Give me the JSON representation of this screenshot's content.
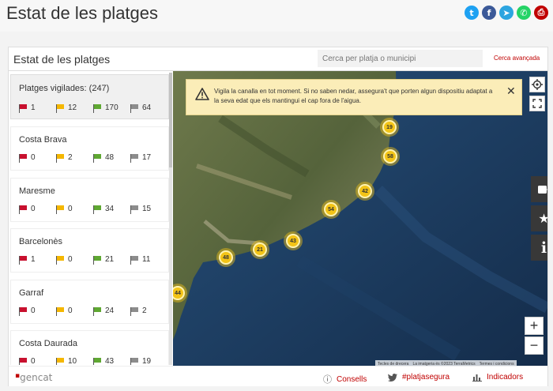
{
  "page": {
    "title": "Estat de les platges"
  },
  "share": [
    {
      "name": "twitter-icon",
      "glyph": "t",
      "color": "#1da1f2"
    },
    {
      "name": "facebook-icon",
      "glyph": "f",
      "color": "#3b5998"
    },
    {
      "name": "telegram-icon",
      "glyph": "➤",
      "color": "#2ca5e0"
    },
    {
      "name": "whatsapp-icon",
      "glyph": "✆",
      "color": "#25d366"
    },
    {
      "name": "print-icon",
      "glyph": "⎙",
      "color": "#c00000"
    }
  ],
  "panel": {
    "title": "Estat de les platges",
    "search_placeholder": "Cerca per platja o municipi",
    "advanced_search": "Cerca avançada"
  },
  "flag_colors": {
    "red": "#c8102e",
    "yellow": "#f5b700",
    "green": "#5fa832",
    "gray": "#8c8c8c"
  },
  "summary": {
    "title": "Platges vigilades: (247)",
    "red": "1",
    "yellow": "12",
    "green": "170",
    "gray": "64"
  },
  "regions": [
    {
      "name": "Costa Brava",
      "red": "0",
      "yellow": "2",
      "green": "48",
      "gray": "17"
    },
    {
      "name": "Maresme",
      "red": "0",
      "yellow": "0",
      "green": "34",
      "gray": "15"
    },
    {
      "name": "Barcelonès",
      "red": "1",
      "yellow": "0",
      "green": "21",
      "gray": "11"
    },
    {
      "name": "Garraf",
      "red": "0",
      "yellow": "0",
      "green": "24",
      "gray": "2"
    },
    {
      "name": "Costa Daurada",
      "red": "0",
      "yellow": "10",
      "green": "43",
      "gray": "19"
    }
  ],
  "alert": {
    "text": "Vigila la canalla en tot moment. Si no saben nedar, assegura't que porten algun dispositiu adaptat a la seva edat que els mantingui el cap fora de l'aigua."
  },
  "clusters": [
    "19",
    "58",
    "42",
    "54",
    "43",
    "21",
    "48",
    "44"
  ],
  "map": {
    "zoom_in": "+",
    "zoom_out": "−",
    "attribution": {
      "shortcuts": "Tecles de drecera",
      "imagery": "La imatgeria és ©2023 TerraMetrics",
      "terms": "Termes i condicions"
    }
  },
  "footer": {
    "logo": "gencat",
    "advice": "Consells",
    "hashtag": "#platjasegura",
    "indicators": "Indicadors"
  }
}
